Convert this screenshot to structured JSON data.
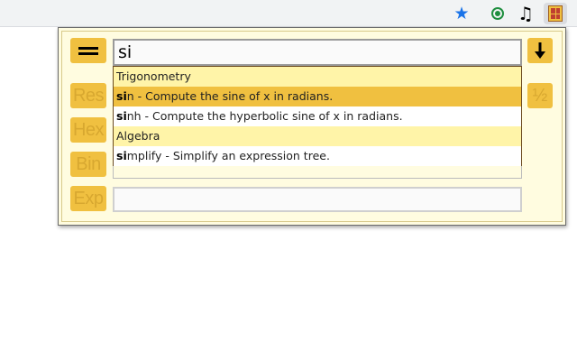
{
  "toolbar": {
    "icons": [
      "star-icon",
      "record-icon",
      "music-icon",
      "calculator-extension-icon"
    ],
    "accent_color": "#1a73e8"
  },
  "calculator": {
    "input_value": "si",
    "buttons": {
      "res": "Res",
      "hex": "Hex",
      "bin": "Bin",
      "exp": "Exp",
      "half": "½"
    },
    "button_color": "#f0c040",
    "panel_color": "#fffce0"
  },
  "autocomplete": {
    "rows": [
      {
        "type": "category",
        "text": "Trigonometry"
      },
      {
        "type": "item",
        "match": "si",
        "rest": "n - Compute the sine of x in radians.",
        "selected": true
      },
      {
        "type": "item",
        "match": "si",
        "rest": "nh - Compute the hyperbolic sine of x in radians.",
        "selected": false
      },
      {
        "type": "category",
        "text": "Algebra"
      },
      {
        "type": "item",
        "match": "si",
        "rest": "mplify - Simplify an expression tree.",
        "selected": false
      }
    ]
  }
}
